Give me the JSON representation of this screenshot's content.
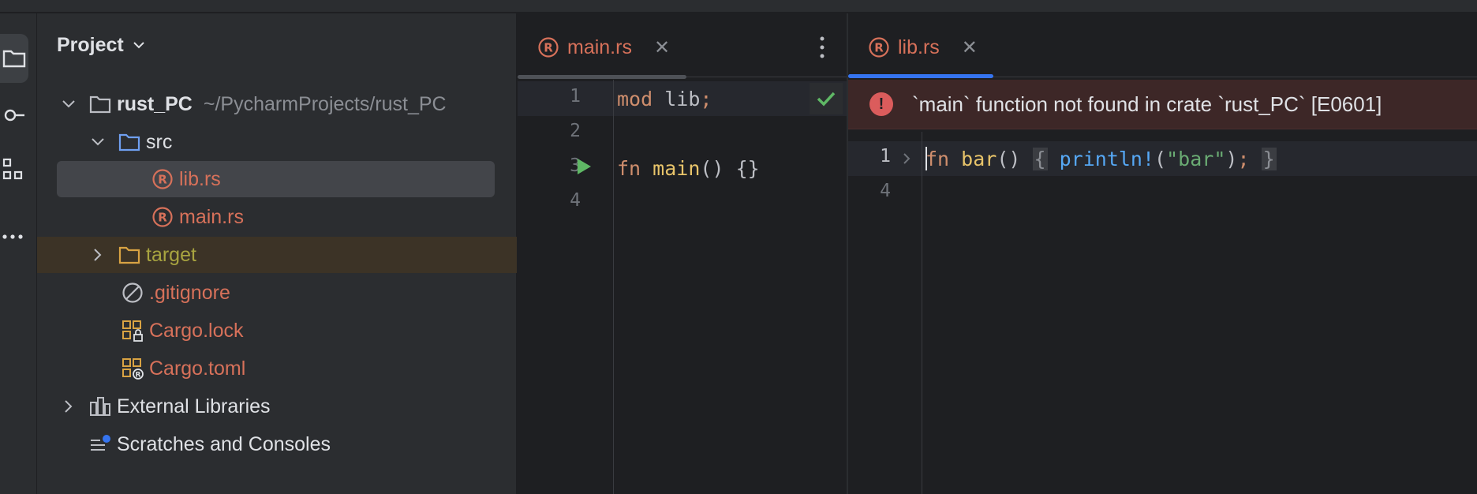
{
  "project_panel": {
    "title": "Project",
    "tree": [
      {
        "name": "rust_PC",
        "path": "~/PycharmProjects/rust_PC"
      },
      {
        "name": "src"
      },
      {
        "name": "lib.rs"
      },
      {
        "name": "main.rs"
      },
      {
        "name": "target"
      },
      {
        "name": ".gitignore"
      },
      {
        "name": "Cargo.lock"
      },
      {
        "name": "Cargo.toml"
      },
      {
        "name": "External Libraries"
      },
      {
        "name": "Scratches and Consoles"
      }
    ]
  },
  "editor_left": {
    "tab_label": "main.rs",
    "lines": [
      {
        "number": "1",
        "tokens": [
          "mod",
          "lib",
          ";"
        ]
      },
      {
        "number": "2"
      },
      {
        "number": "3",
        "tokens": [
          "fn",
          "main",
          "()",
          "{}"
        ]
      },
      {
        "number": "4"
      }
    ]
  },
  "editor_right": {
    "tab_label": "lib.rs",
    "error_message": "`main` function not found in crate `rust_PC` [E0601]",
    "lines": [
      {
        "number": "1",
        "tokens": [
          "fn",
          "bar",
          "()",
          "{",
          "println!",
          "(",
          "\"bar\"",
          ")",
          ";",
          "}"
        ]
      },
      {
        "number": "4"
      }
    ]
  },
  "colors": {
    "background": "#1e1f22",
    "panel": "#2b2d30",
    "file_name_red": "#d7715a",
    "excluded_folder": "#a8a440",
    "error_background": "#3d2727",
    "active_tab_underline": "#3574f0"
  }
}
